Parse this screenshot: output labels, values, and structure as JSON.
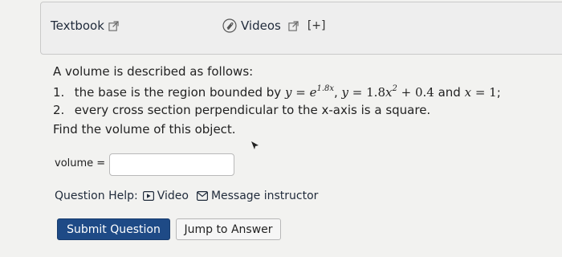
{
  "header": {
    "textbook_label": "Textbook",
    "videos_label": "Videos",
    "videos_expand": "[+]"
  },
  "problem": {
    "intro": "A volume is described as follows:",
    "item1_num": "1.",
    "item1_text": "the base is the region bounded by",
    "item1_and": "and",
    "item2_num": "2.",
    "item2_text": "every cross section perpendicular to the x-axis is a square.",
    "find": "Find the volume of this object."
  },
  "answer": {
    "label": "volume =",
    "value": "",
    "placeholder": ""
  },
  "help": {
    "label": "Question Help:",
    "video_label": "Video",
    "message_label": "Message instructor"
  },
  "buttons": {
    "submit": "Submit Question",
    "jump": "Jump to Answer"
  },
  "icons": {
    "textbook": "external-link-icon",
    "videos_clip": "paperclip-icon",
    "videos": "external-link-icon",
    "video_help": "play-icon",
    "message": "mail-icon"
  }
}
